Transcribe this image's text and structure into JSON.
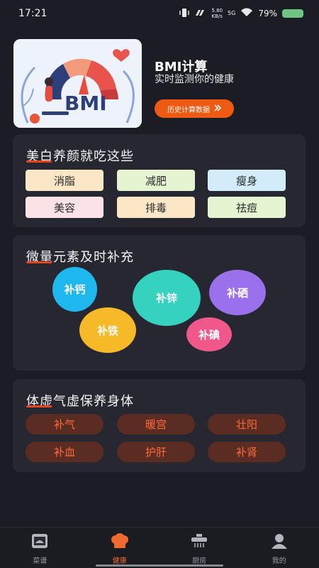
{
  "status": {
    "time": "17:21",
    "net_speed_value": "5.80",
    "net_speed_unit": "KB/s",
    "network": "5G",
    "battery": "79%"
  },
  "bmi": {
    "title": "BMI计算",
    "subtitle": "实时监测你的健康",
    "history_label": "历史计算数据",
    "image_text": "BMI"
  },
  "whitening": {
    "title": "美白养颜就吃这些",
    "tags": [
      {
        "label": "消脂",
        "color": "#fbe7c6"
      },
      {
        "label": "减肥",
        "color": "#e5f5d2"
      },
      {
        "label": "瘦身",
        "color": "#d2edf9"
      },
      {
        "label": "美容",
        "color": "#fbe2e6"
      },
      {
        "label": "排毒",
        "color": "#fbe7c6"
      },
      {
        "label": "祛痘",
        "color": "#e5f5d2"
      }
    ]
  },
  "trace": {
    "title": "微量元素及时补充",
    "bubbles": [
      {
        "label": "补钙",
        "color": "#1fb8ee"
      },
      {
        "label": "补锌",
        "color": "#35d3bf"
      },
      {
        "label": "补硒",
        "color": "#9a70ec"
      },
      {
        "label": "补铁",
        "color": "#f6b928"
      },
      {
        "label": "补碘",
        "color": "#f0588c"
      }
    ]
  },
  "weak": {
    "title": "体虚气虚保养身体",
    "items": [
      "补气",
      "暖宫",
      "壮阳",
      "补血",
      "护肝",
      "补肾"
    ]
  },
  "nav": {
    "items": [
      {
        "label": "菜谱",
        "icon": "recipe-icon"
      },
      {
        "label": "健康",
        "icon": "chef-hat-icon"
      },
      {
        "label": "厨房",
        "icon": "kitchen-icon"
      },
      {
        "label": "我的",
        "icon": "profile-icon"
      }
    ],
    "active_color": "#ef6a2c"
  }
}
